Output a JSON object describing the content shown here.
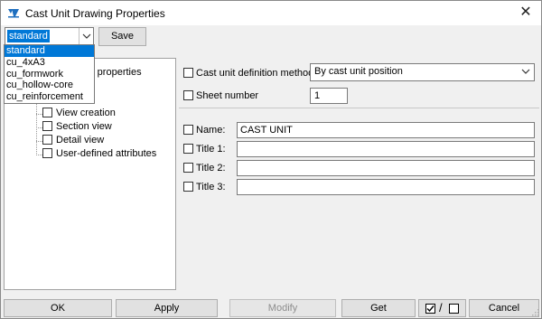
{
  "window": {
    "title": "Cast Unit Drawing Properties",
    "icon": "tekla-drawing-icon",
    "close_icon": "close-icon"
  },
  "toolbar": {
    "settings_value": "standard",
    "save_label": "Save",
    "dropdown_options": [
      "standard",
      "cu_4xA3",
      "cu_formwork",
      "cu_hollow-core",
      "cu_reinforcement"
    ],
    "selected_option": "standard"
  },
  "tree": {
    "root_label_partial": "wing properties",
    "items": [
      "View creation",
      "Section view",
      "Detail view",
      "User-defined attributes"
    ]
  },
  "top_form": {
    "definition_label": "Cast unit definition method",
    "definition_value": "By cast unit position",
    "sheet_label": "Sheet number",
    "sheet_value": "1"
  },
  "title_form": {
    "rows": [
      {
        "label": "Name:",
        "value": "CAST UNIT"
      },
      {
        "label": "Title 1:",
        "value": ""
      },
      {
        "label": "Title 2:",
        "value": ""
      },
      {
        "label": "Title 3:",
        "value": ""
      }
    ]
  },
  "buttons": {
    "ok": "OK",
    "apply": "Apply",
    "modify": "Modify",
    "get": "Get",
    "toggle_slash": "/",
    "cancel": "Cancel"
  },
  "colors": {
    "selection": "#0078d7",
    "button_face": "#e1e1e1",
    "dialog_bg": "#f0f0f0"
  }
}
